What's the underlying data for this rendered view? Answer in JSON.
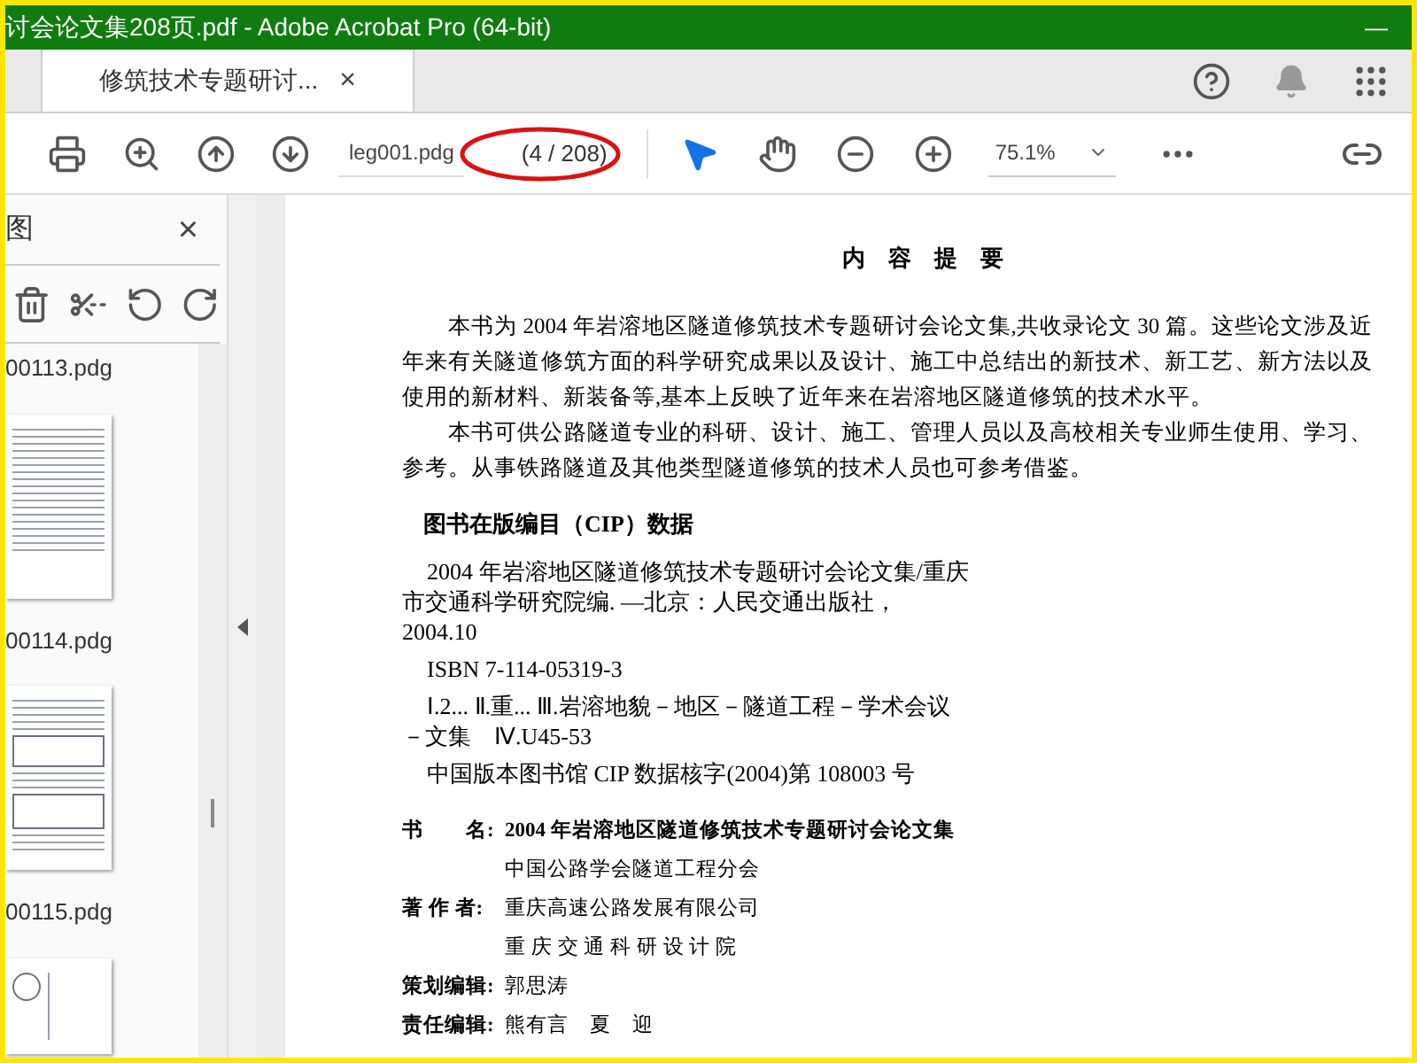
{
  "window": {
    "title": "讨会论文集208页.pdf - Adobe Acrobat Pro (64-bit)",
    "minimize": "—"
  },
  "tabs": [
    {
      "label": "修筑技术专题研讨...",
      "close": "×",
      "selected": true
    }
  ],
  "toolbar": {
    "file_field": "leg001.pdg",
    "page_indicator": "(4 / 208)",
    "zoom": "75.1%",
    "tools": [
      {
        "kind": "select",
        "selected": true
      },
      {
        "kind": "hand",
        "selected": false
      }
    ]
  },
  "side_panel": {
    "title": "图",
    "close": "×",
    "thumbnails": [
      {
        "label": "00113.pdg",
        "kind": "text"
      },
      {
        "label": "00114.pdg",
        "kind": "figure"
      },
      {
        "label": "00115.pdg",
        "kind": "diagram"
      }
    ]
  },
  "document": {
    "heading": "内　容　提　要",
    "paragraphs": [
      "本书为 2004 年岩溶地区隧道修筑技术专题研讨会论文集,共收录论文 30 篇。这些论文涉及近年来有关隧道修筑方面的科学研究成果以及设计、施工中总结出的新技术、新工艺、新方法以及使用的新材料、新装备等,基本上反映了近年来在岩溶地区隧道修筑的技术水平。",
      "本书可供公路隧道专业的科研、设计、施工、管理人员以及高校相关专业师生使用、学习、参考。从事铁路隧道及其他类型隧道修筑的技术人员也可参考借鉴。"
    ],
    "cip_heading": "图书在版编目（CIP）数据",
    "cip_entries": [
      "2004 年岩溶地区隧道修筑技术专题研讨会论文集/重庆市交通科学研究院编. —北京：人民交通出版社，2004.10",
      "ISBN 7-114-05319-3",
      "Ⅰ.2... Ⅱ.重... Ⅲ.岩溶地貌－地区－隧道工程－学术会议－文集　Ⅳ.U45-53",
      "中国版本图书馆 CIP 数据核字(2004)第 108003 号"
    ],
    "credits": [
      {
        "label": "书　　名:",
        "values": [
          "2004 年岩溶地区隧道修筑技术专题研讨会论文集",
          "中国公路学会隧道工程分会"
        ]
      },
      {
        "label": "著 作 者:",
        "values": [
          "重庆高速公路发展有限公司",
          "重 庆 交 通 科 研 设 计 院"
        ]
      },
      {
        "label": "策划编辑:",
        "values": [
          "郭思涛"
        ]
      },
      {
        "label": "责任编辑:",
        "values": [
          "熊有言　夏　迎"
        ]
      }
    ]
  }
}
